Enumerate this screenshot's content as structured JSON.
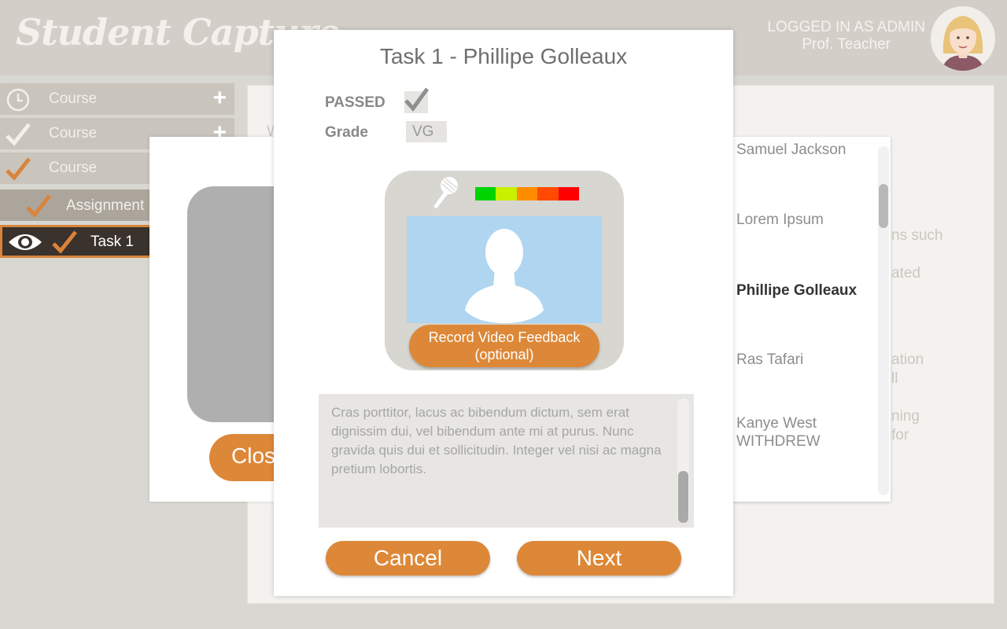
{
  "header": {
    "logo_text": "Student Capture",
    "login_line1": "LOGGED IN AS ADMIN",
    "login_line2": "Prof. Teacher"
  },
  "sidebar": {
    "items": [
      {
        "label": "Course",
        "icon": "clock-icon"
      },
      {
        "label": "Course",
        "icon": "check-icon"
      },
      {
        "label": "Course",
        "icon": "check-icon"
      },
      {
        "label": "Assignment",
        "icon": "check-icon"
      },
      {
        "label": "Task 1",
        "icon": "check-icon"
      }
    ],
    "add_label": "+"
  },
  "background": {
    "fragments": [
      "W",
      "ns such",
      "ated",
      "ation",
      "ll",
      "ning",
      "for"
    ],
    "close_label": "Close"
  },
  "students": [
    {
      "name": "Samuel Jackson"
    },
    {
      "name": "Lorem Ipsum"
    },
    {
      "name": "Phillipe Golleaux"
    },
    {
      "name": "Ras Tafari"
    },
    {
      "name": "Kanye West",
      "status": "WITHDREW"
    }
  ],
  "dialog": {
    "title": "Task 1 - Phillipe Golleaux",
    "passed_label": "PASSED",
    "passed": true,
    "grade_label": "Grade",
    "grade_value": "VG",
    "record_label_line1": "Record Video Feedback",
    "record_label_line2": "(optional)",
    "feedback_text": "Cras porttitor, lacus ac bibendum dictum, sem erat dignissim dui, vel bibendum ante mi at purus. Nunc gravida quis dui et sollicitudin. Integer vel nisi ac magna pretium lobortis.",
    "cancel_label": "Cancel",
    "next_label": "Next"
  },
  "colors": {
    "accent": "#dd8838",
    "meter": [
      "#00d400",
      "#c8f000",
      "#ff8c00",
      "#ff4a00",
      "#ff0000"
    ]
  }
}
